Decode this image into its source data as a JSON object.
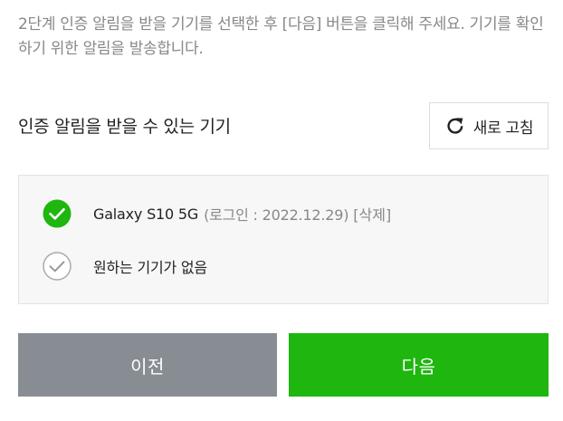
{
  "description": "2단계 인증 알림을 받을 기기를 선택한 후 [다음] 버튼을 클릭해 주세요. 기기를 확인하기 위한 알림을 발송합니다.",
  "section": {
    "title": "인증 알림을 받을 수 있는 기기",
    "refresh_label": "새로 고침",
    "refresh_icon": "refresh-icon"
  },
  "devices": [
    {
      "name": "Galaxy S10 5G",
      "meta": "(로그인 : 2022.12.29)",
      "delete_label": "[삭제]",
      "selected": true,
      "check_color": "#1eb60f"
    },
    {
      "name": "원하는 기기가 없음",
      "selected": false,
      "check_color": "#aaaaaa"
    }
  ],
  "buttons": {
    "prev_label": "이전",
    "next_label": "다음",
    "prev_color": "#878d92",
    "next_color": "#1eb60f"
  }
}
